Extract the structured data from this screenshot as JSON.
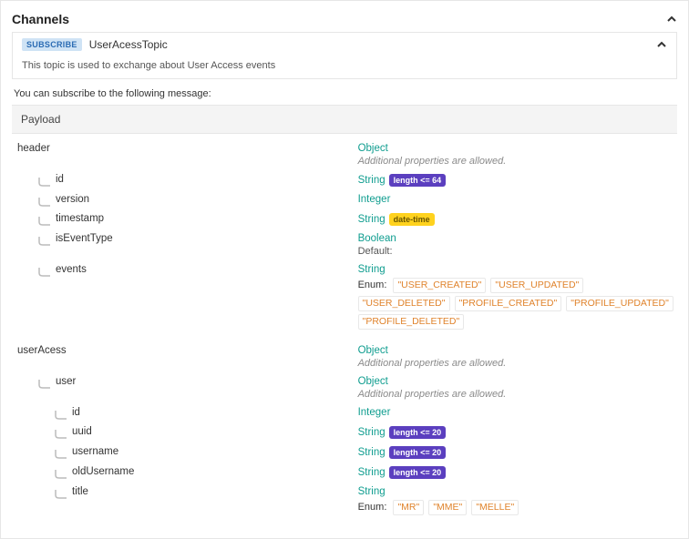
{
  "section": {
    "title": "Channels"
  },
  "topic": {
    "badge": "SUBSCRIBE",
    "name": "UserAcessTopic",
    "description": "This topic is used to exchange about User Access events"
  },
  "subscribeNote": "You can subscribe to the following message:",
  "payloadLabel": "Payload",
  "typeLabels": {
    "object": "Object",
    "string": "String",
    "integer": "Integer",
    "boolean": "Boolean"
  },
  "notes": {
    "additionalProps": "Additional properties are allowed.",
    "default": "Default:",
    "enum": "Enum:"
  },
  "pills": {
    "len64": "length <= 64",
    "len20": "length <= 20",
    "dateTime": "date-time"
  },
  "schema": {
    "header": {
      "name": "header",
      "fields": {
        "id": "id",
        "version": "version",
        "timestamp": "timestamp",
        "isEventType": "isEventType",
        "events": "events"
      },
      "eventsEnum": [
        "\"USER_CREATED\"",
        "\"USER_UPDATED\"",
        "\"USER_DELETED\"",
        "\"PROFILE_CREATED\"",
        "\"PROFILE_UPDATED\"",
        "\"PROFILE_DELETED\""
      ]
    },
    "userAcess": {
      "name": "userAcess",
      "user": {
        "name": "user",
        "fields": {
          "id": "id",
          "uuid": "uuid",
          "username": "username",
          "oldUsername": "oldUsername",
          "title": "title"
        },
        "titleEnum": [
          "\"MR\"",
          "\"MME\"",
          "\"MELLE\""
        ]
      }
    }
  }
}
